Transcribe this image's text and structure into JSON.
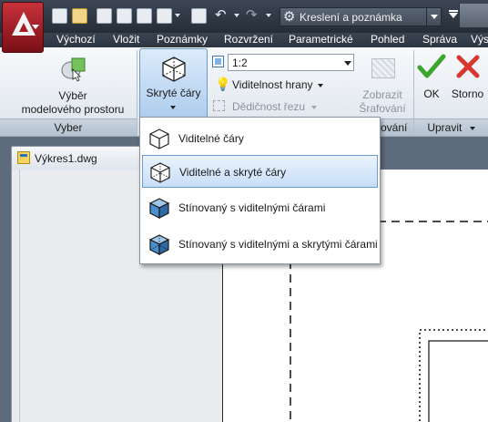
{
  "quick_access": {
    "workspace_label": "Kreslení a poznámka"
  },
  "ribbon_tabs": [
    "Výchozí",
    "Vložit",
    "Poznámky",
    "Rozvržení",
    "Parametrické",
    "Pohled",
    "Správa",
    "Výs"
  ],
  "ribbon": {
    "panel_vyber": {
      "button_line1": "Výběr",
      "button_line2": "modelového prostoru",
      "footer": "Vyber"
    },
    "hidden_lines_button": "Skryté čáry",
    "scale_value": "1:2",
    "edge_visibility": "Viditelnost hrany",
    "section_inheritance": "Dědičnost řezu",
    "show_hatch_line1": "Zobrazit",
    "show_hatch_line2": "Šrafování",
    "panel_partial_footer": "ování",
    "ok_label": "OK",
    "cancel_label": "Storno",
    "panel_upravit_footer": "Upravit"
  },
  "document": {
    "tab_title": "Výkres1.dwg"
  },
  "dropdown": {
    "items": [
      {
        "label": "Viditelné čáry",
        "icon": "visible-lines-icon",
        "selected": false
      },
      {
        "label": "Viditelné a skryté čáry",
        "icon": "visible-hidden-lines-icon",
        "selected": true
      },
      {
        "label": "Stínovaný s viditelnými čárami",
        "icon": "shaded-visible-icon",
        "selected": false
      },
      {
        "label": "Stínovaný s viditelnými a skrytými čárami",
        "icon": "shaded-visible-hidden-icon",
        "selected": false
      }
    ]
  },
  "colors": {
    "accent_selected": "#c7def7",
    "ribbon_background": "#dde4ec",
    "title_bar": "#2d3541"
  }
}
